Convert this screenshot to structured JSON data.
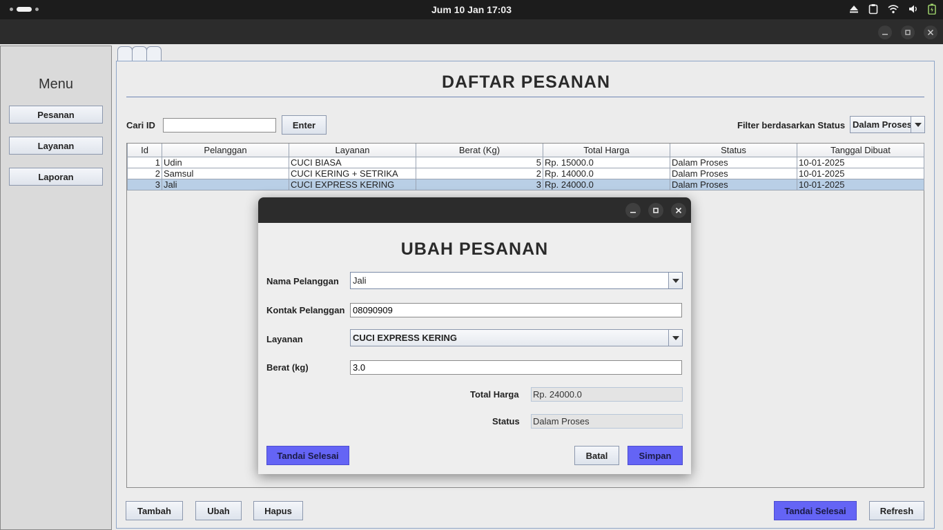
{
  "system_bar": {
    "clock": "Jum 10 Jan  17:03"
  },
  "sidebar": {
    "title": "Menu",
    "items": [
      {
        "label": "Pesanan"
      },
      {
        "label": "Layanan"
      },
      {
        "label": "Laporan"
      }
    ]
  },
  "main": {
    "title": "DAFTAR PESANAN",
    "search": {
      "label": "Cari ID",
      "value": "",
      "button": "Enter"
    },
    "filter": {
      "label": "Filter berdasarkan Status",
      "selected": "Dalam Proses"
    },
    "table": {
      "columns": [
        "Id",
        "Pelanggan",
        "Layanan",
        "Berat (Kg)",
        "Total Harga",
        "Status",
        "Tanggal Dibuat"
      ],
      "rows": [
        [
          "1",
          "Udin",
          "CUCI BIASA",
          "5",
          "Rp. 15000.0",
          "Dalam Proses",
          "10-01-2025"
        ],
        [
          "2",
          "Samsul",
          "CUCI KERING + SETRIKA",
          "2",
          "Rp. 14000.0",
          "Dalam Proses",
          "10-01-2025"
        ],
        [
          "3",
          "Jali",
          "CUCI EXPRESS KERING",
          "3",
          "Rp. 24000.0",
          "Dalam Proses",
          "10-01-2025"
        ]
      ],
      "selected_row": 3
    },
    "buttons": {
      "tambah": "Tambah",
      "ubah": "Ubah",
      "hapus": "Hapus",
      "tandai_selesai": "Tandai Selesai",
      "refresh": "Refresh"
    }
  },
  "dialog": {
    "title": "UBAH PESANAN",
    "nama_label": "Nama Pelanggan",
    "nama_value": "Jali",
    "kontak_label": "Kontak Pelanggan",
    "kontak_value": "08090909",
    "layanan_label": "Layanan",
    "layanan_value": "CUCI EXPRESS KERING",
    "berat_label": "Berat (kg)",
    "berat_value": "3.0",
    "total_label": "Total Harga",
    "total_value": "Rp. 24000.0",
    "status_label": "Status",
    "status_value": "Dalam Proses",
    "btn_tandai": "Tandai Selesai",
    "btn_batal": "Batal",
    "btn_simpan": "Simpan"
  },
  "colors": {
    "primary_button": "#6464f5",
    "selected_row": "#b9cfe6",
    "title_bar": "#2c2c2c"
  }
}
